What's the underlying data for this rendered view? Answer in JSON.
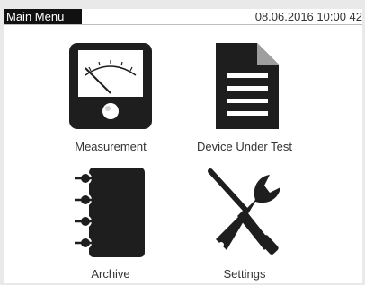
{
  "header": {
    "title": "Main Menu",
    "datetime": "08.06.2016 10:00 42"
  },
  "menu": [
    {
      "label": "Measurement",
      "icon": "analog-meter-icon"
    },
    {
      "label": "Device Under Test",
      "icon": "document-icon"
    },
    {
      "label": "Archive",
      "icon": "notebook-icon"
    },
    {
      "label": "Settings",
      "icon": "wrench-screwdriver-icon"
    }
  ],
  "colors": {
    "icon": "#1e1e1e",
    "title_bg": "#111111",
    "page_fold": "#9e9e9e"
  }
}
